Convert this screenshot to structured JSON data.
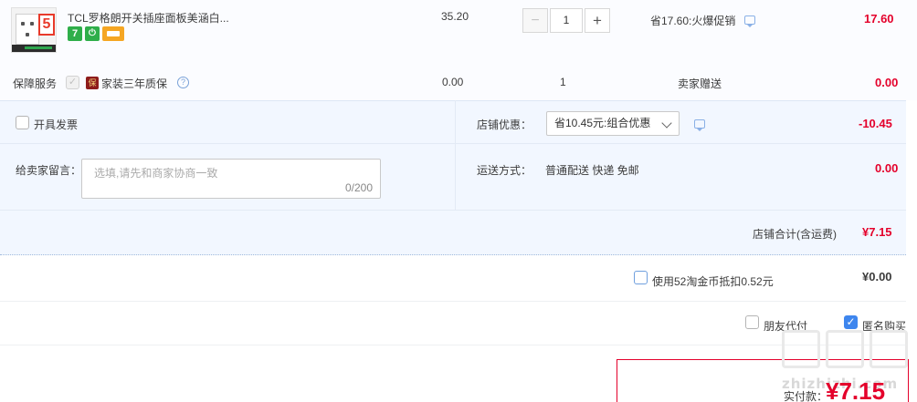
{
  "product": {
    "title": "TCL罗格朗开关插座面板美涵白...",
    "price": "35.20",
    "thumb_number": "5",
    "quantity": "1",
    "qty_minus": "−",
    "qty_plus": "+",
    "promo": "省17.60:火爆促销",
    "subtotal": "17.60",
    "badges": [
      {
        "icon": "seven-day-return-icon",
        "label": "7",
        "color": "#2fae4a"
      },
      {
        "icon": "power-plug-icon",
        "label": "⏻",
        "color": "#2fae4a"
      },
      {
        "icon": "card-payment-icon",
        "label": "",
        "color": "#f5a623"
      }
    ]
  },
  "service": {
    "label": "保障服务",
    "shield_glyph": "保",
    "name": "家装三年质保",
    "price": "0.00",
    "quantity": "1",
    "note": "卖家赠送",
    "subtotal": "0.00",
    "help_glyph": "?"
  },
  "invoice": {
    "label": "开具发票"
  },
  "shop_discount": {
    "label": "店铺优惠：",
    "selected": "省10.45元:组合优惠",
    "amount": "-10.45"
  },
  "message": {
    "label": "给卖家留言：",
    "placeholder": "选填,请先和商家协商一致",
    "counter": "0/200"
  },
  "shipping": {
    "label": "运送方式：",
    "value": "普通配送 快递 免邮",
    "amount": "0.00"
  },
  "shop_total": {
    "label": "店铺合计(含运费)",
    "amount": "¥7.15"
  },
  "coins": {
    "label": "使用52淘金币抵扣0.52元",
    "amount": "¥0.00"
  },
  "options": {
    "friend_pay": "朋友代付",
    "anonymous": "匿名购买",
    "check_mark": "✓"
  },
  "final": {
    "label": "实付款：",
    "amount": "¥7.15"
  },
  "watermark": {
    "text": "zhizhizhi.com"
  },
  "colors": {
    "accent_red": "#e4002b",
    "accent_blue": "#3e86ee",
    "panel_blue": "#f2f7ff"
  }
}
